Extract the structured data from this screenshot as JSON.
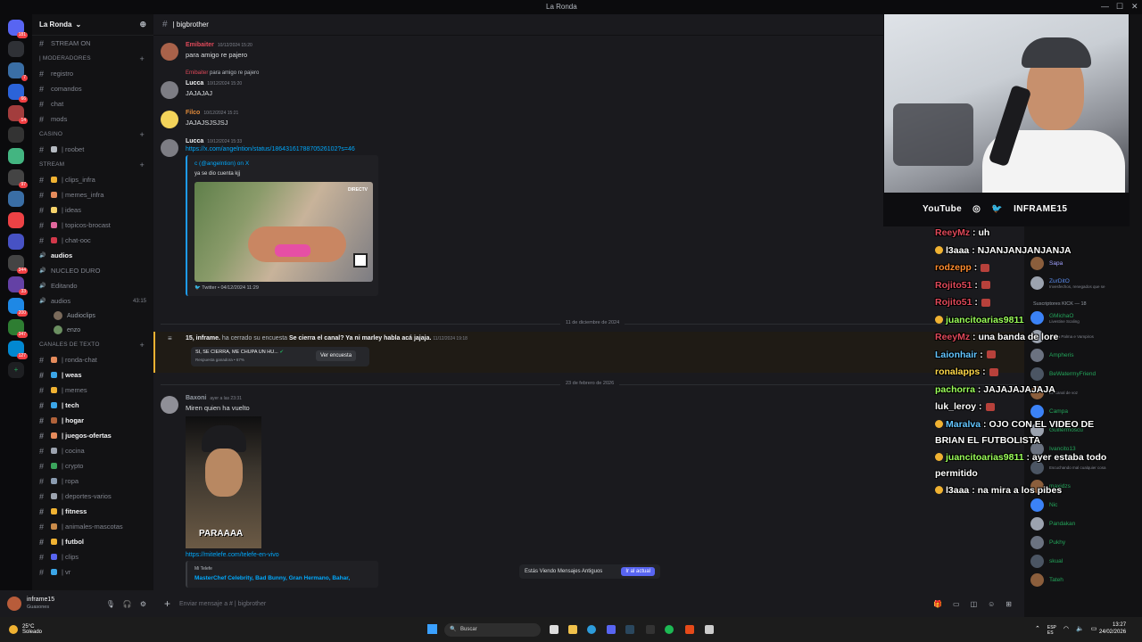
{
  "window": {
    "title": "La Ronda",
    "controls": [
      "—",
      "☐",
      "✕"
    ]
  },
  "server": {
    "name": "La Ronda",
    "items": [
      {
        "kind": "channel",
        "label": "STREAM ON",
        "bright": false
      },
      {
        "kind": "category",
        "label": "| Moderadores"
      },
      {
        "kind": "channel",
        "label": "registro"
      },
      {
        "kind": "channel",
        "label": "comandos"
      },
      {
        "kind": "channel",
        "label": "chat"
      },
      {
        "kind": "channel",
        "label": "mods"
      },
      {
        "kind": "category",
        "label": "CASINO"
      },
      {
        "kind": "channel",
        "label": "| roobet",
        "emoji": "#b5bac1"
      },
      {
        "kind": "category",
        "label": "STREAM"
      },
      {
        "kind": "channel",
        "label": "| clips_infra",
        "emoji": "#f0b232"
      },
      {
        "kind": "channel",
        "label": "| memes_infra",
        "emoji": "#e58b5c"
      },
      {
        "kind": "channel",
        "label": "| ideas",
        "emoji": "#f6d36b"
      },
      {
        "kind": "channel",
        "label": "| topicos-brocast",
        "emoji": "#e0679d"
      },
      {
        "kind": "channel",
        "label": "| chat-ooc",
        "emoji": "#d2384a"
      },
      {
        "kind": "voice",
        "label": "audios",
        "bright": true
      },
      {
        "kind": "voice",
        "label": "NUCLEO DURO"
      },
      {
        "kind": "voice",
        "label": "Editando"
      },
      {
        "kind": "voice",
        "label": "audios",
        "count": "43:15"
      },
      {
        "kind": "vuser",
        "label": "Audioclips",
        "color": "#7a6a5b"
      },
      {
        "kind": "vuser",
        "label": "enzo",
        "color": "#6b8f61"
      },
      {
        "kind": "category",
        "label": "CANALES DE TEXTO"
      },
      {
        "kind": "channel",
        "label": "| ronda-chat",
        "emoji": "#e58b5c"
      },
      {
        "kind": "channel",
        "label": "| weas",
        "emoji": "#3ba6e8",
        "bright": true
      },
      {
        "kind": "channel",
        "label": "| memes",
        "emoji": "#f0b232"
      },
      {
        "kind": "channel",
        "label": "| tech",
        "emoji": "#3ba6e8",
        "bright": true
      },
      {
        "kind": "channel",
        "label": "| hogar",
        "emoji": "#b0623a",
        "bright": true
      },
      {
        "kind": "channel",
        "label": "| juegos-ofertas",
        "emoji": "#e58b5c",
        "bright": true
      },
      {
        "kind": "channel",
        "label": "| cocina",
        "emoji": "#9ca3af"
      },
      {
        "kind": "channel",
        "label": "| crypto",
        "emoji": "#3ba55c"
      },
      {
        "kind": "channel",
        "label": "| ropa",
        "emoji": "#8a9bb0"
      },
      {
        "kind": "channel",
        "label": "| deportes-varios",
        "emoji": "#9ca3af"
      },
      {
        "kind": "channel",
        "label": "| fitness",
        "emoji": "#f0b232",
        "bright": true
      },
      {
        "kind": "channel",
        "label": "| animales-mascotas",
        "emoji": "#c98b4a"
      },
      {
        "kind": "channel",
        "label": "| futbol",
        "emoji": "#f0b232",
        "bright": true
      },
      {
        "kind": "channel",
        "label": "| clips",
        "emoji": "#5865f2"
      },
      {
        "kind": "channel",
        "label": "| vr",
        "emoji": "#3ba6e8"
      }
    ]
  },
  "guilds": [
    {
      "color": "#5865f2",
      "label": "",
      "badge": "181"
    },
    {
      "color": "#2f3136",
      "label": "",
      "badge": ""
    },
    {
      "color": "#3a6ea5",
      "label": "",
      "badge": "7"
    },
    {
      "color": "#2b63d9",
      "label": "",
      "badge": "66"
    },
    {
      "color": "#a33d3d",
      "label": "",
      "badge": "14"
    },
    {
      "color": "#333",
      "label": "",
      "badge": ""
    },
    {
      "color": "#43b581",
      "label": "",
      "badge": ""
    },
    {
      "color": "#444",
      "label": "",
      "badge": "97"
    },
    {
      "color": "#3a6ea5",
      "label": "",
      "badge": ""
    },
    {
      "color": "#ed4245",
      "label": "",
      "badge": ""
    },
    {
      "color": "#4752c4",
      "label": "",
      "badge": ""
    },
    {
      "color": "#444",
      "label": "",
      "badge": "344"
    },
    {
      "color": "#6441a5",
      "label": "",
      "badge": "33"
    },
    {
      "color": "#1e88e5",
      "label": "",
      "badge": "200"
    },
    {
      "color": "#2e7d32",
      "label": "",
      "badge": "347"
    },
    {
      "color": "#0288d1",
      "label": "",
      "badge": "127"
    }
  ],
  "user_panel": {
    "name": "inframe15",
    "status": "Guasones"
  },
  "channel_header": {
    "name": "| bigbrother"
  },
  "messages": {
    "m1": {
      "author": "Emibaiter",
      "ts": "10/12/2024 15:20",
      "text": "para amigo re pajero"
    },
    "reply2": {
      "author": "Emibaiter",
      "text": "para amigo re pajero"
    },
    "m2": {
      "author": "Lucca",
      "ts": "10/12/2024 15:20",
      "text": "JAJAJAJ"
    },
    "m3": {
      "author": "Filco",
      "ts": "10/12/2024 15:21",
      "text": "JAJAJSJSJSJ"
    },
    "m4": {
      "author": "Lucca",
      "ts": "10/12/2024 15:33",
      "link": "https://x.com/angelntion/status/1864316178870526102?s=46",
      "embed_title": "c (@angelntion) on X",
      "embed_desc": "ya se dio cuenta kjj",
      "embed_footer": "Twitter • 04/12/2024 11:29",
      "image_tag": "DIRECTV"
    },
    "m5": {
      "author": "Baxoni",
      "ts": "ayer a las 23:31",
      "text": "Miren quien ha vuelto",
      "gif_caption": "PARAAAA",
      "link": "https://mitelefe.com/telefe-en-vivo",
      "embed_site": "Mi Telefe",
      "embed_title": "MasterChef Celebrity, Bad Bunny, Gran Hermano, Bahar,"
    }
  },
  "dividers": {
    "d1": "11 de diciembre de 2024",
    "d2": "23 de febrero de 2026"
  },
  "poll": {
    "actor": "15, inframe.",
    "action": "ha cerrado su encuesta",
    "question": "Se cierra el canal? Ya ni marley habla acá jajaja.",
    "ts": "11/12/2024 19:18",
    "winner": "SI, SE CIERRA, ME CHUPA UN HU...",
    "winner_sub": "Respuesta ganadora • 67%",
    "button": "Ver encuesta"
  },
  "jump_bar": {
    "text": "Estás Viendo Mensajes Antiguos",
    "button": "Ir al actual"
  },
  "composer": {
    "placeholder": "Enviar mensaje a # | bigbrother"
  },
  "members": {
    "top": [
      {
        "name": "Sapa",
        "color": "#a0a0ff",
        "sub": ""
      },
      {
        "name": "ZurDitO",
        "color": "#5b8def",
        "sub": "Invesfechos, renegados que se"
      }
    ],
    "category": "Suscriptores KICK — 18",
    "list": [
      {
        "name": "GMichaO",
        "sub": "Livestine Scaling",
        "color": "#23a55a"
      },
      {
        "name": "",
        "sub": "Villma Palma e Vampiros",
        "color": "#23a55a"
      },
      {
        "name": "Ampheris",
        "sub": "",
        "color": "#23a55a"
      },
      {
        "name": "BeWatermyFriend",
        "sub": "",
        "color": "#23a55a"
      },
      {
        "name": "",
        "sub": "En canal de voz",
        "color": "#23a55a"
      },
      {
        "name": "Campa",
        "sub": "",
        "color": "#23a55a"
      },
      {
        "name": "Guillermoscu",
        "sub": "",
        "color": "#23a55a"
      },
      {
        "name": "Ivancito13",
        "sub": "",
        "color": "#23a55a"
      },
      {
        "name": "",
        "sub": "Escuchando mal cualquier cosa",
        "color": "#23a55a"
      },
      {
        "name": "maxidzs",
        "sub": "",
        "color": "#23a55a"
      },
      {
        "name": "Nic",
        "sub": "",
        "color": "#23a55a"
      },
      {
        "name": "Pandakan",
        "sub": "",
        "color": "#23a55a"
      },
      {
        "name": "Pukhy",
        "sub": "",
        "color": "#23a55a"
      },
      {
        "name": "skual",
        "sub": "",
        "color": "#23a55a"
      },
      {
        "name": "Tateh",
        "sub": "",
        "color": "#23a55a"
      }
    ]
  },
  "stream_overlay": {
    "socials": [
      "YouTube",
      "INFRAME15"
    ],
    "chat": [
      {
        "user": "ReeyMz",
        "color": "#e0495a",
        "msg": ": uh",
        "badge": false
      },
      {
        "user": "l3aaa",
        "color": "#ffffff",
        "msg": ": NJANJANJANJANJA",
        "badge": true
      },
      {
        "user": "rodzepp",
        "color": "#ff8c2f",
        "msg": ":",
        "emote": true
      },
      {
        "user": "Rojito51",
        "color": "#e0495a",
        "msg": ":",
        "emote": true
      },
      {
        "user": "Rojito51",
        "color": "#e0495a",
        "msg": ":",
        "emote": true
      },
      {
        "user": "juancitoarias9811",
        "color": "#9bff5a",
        "msg": "",
        "badge": true
      },
      {
        "user": "ReeyMz",
        "color": "#e0495a",
        "msg": ": una banda de lore"
      },
      {
        "user": "Laionhair",
        "color": "#63c5ff",
        "msg": ":",
        "emote": true
      },
      {
        "user": "ronalapps",
        "color": "#ffd84a",
        "msg": ":",
        "emote": true
      },
      {
        "user": "pachorra",
        "color": "#9bff5a",
        "msg": ": JAJAJAJAJAJA"
      },
      {
        "user": "luk_leroy",
        "color": "#ffffff",
        "msg": ":",
        "emote": true
      },
      {
        "user": "Maralva",
        "color": "#63c5ff",
        "msg": ": OJO CON EL VIDEO DE BRIAN EL FUTBOLISTA",
        "badge": true,
        "wrap": true
      },
      {
        "user": "juancitoarias9811",
        "color": "#9bff5a",
        "msg": ": ayer estaba todo permitido",
        "badge": true,
        "wrap": true
      },
      {
        "user": "l3aaa",
        "color": "#ffffff",
        "msg": ": na mira a los pibes",
        "badge": true
      }
    ]
  },
  "taskbar": {
    "temp": "25°C",
    "weather": "Soleado",
    "search": "Buscar",
    "lang": "ESP",
    "lang2": "ES",
    "time": "13:27",
    "date": "24/02/2026"
  }
}
